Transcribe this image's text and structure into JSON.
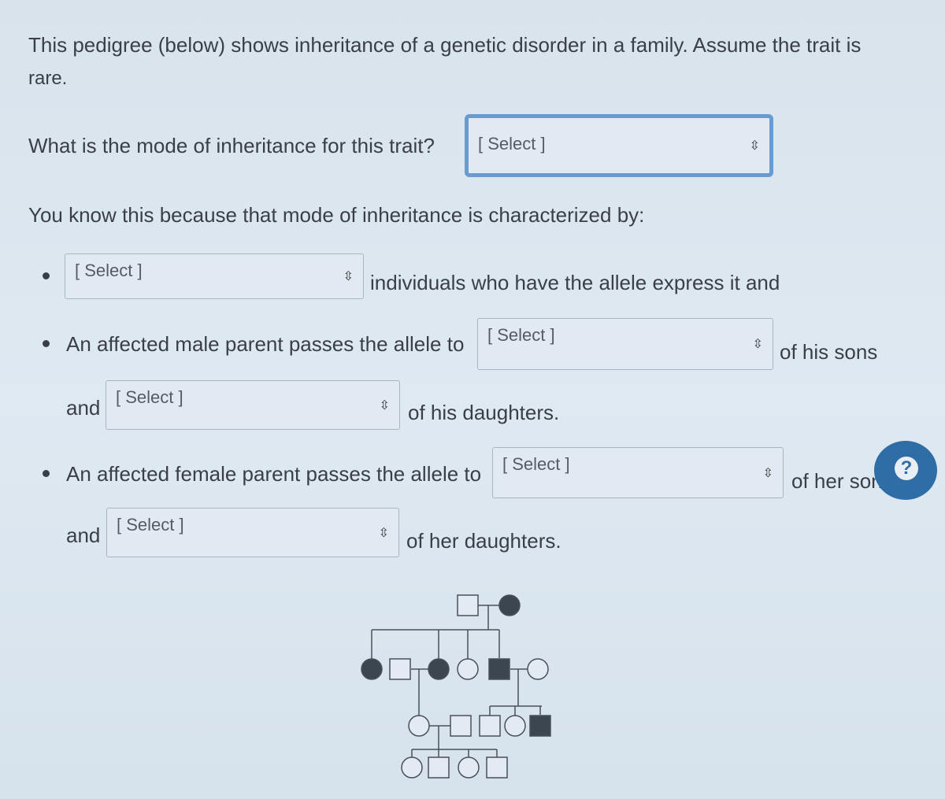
{
  "intro": "This pedigree (below) shows inheritance of a genetic disorder in a family. Assume the trait is",
  "intro2": "rare.",
  "q1": {
    "label": "What is the mode of inheritance for this trait?",
    "select": "[ Select ]"
  },
  "q2_label": "You know this because that mode of inheritance is characterized by:",
  "b1": {
    "select": "[ Select ]",
    "after": "individuals who have the allele express it and"
  },
  "b2": {
    "before": "An affected male parent passes the allele to",
    "select": "[ Select ]",
    "after": "of his sons",
    "and": "and",
    "select2": "[ Select ]",
    "after2": "of his daughters."
  },
  "b3": {
    "before": "An affected female parent passes the allele to",
    "select": "[ Select ]",
    "after": "of her sons",
    "and": "and",
    "select2": "[ Select ]",
    "after2": "of her daughters."
  },
  "help_icon": "question-mark-icon",
  "arrow_icon": "up-down-chevron-icon",
  "colors": {
    "affected": "#3c4650",
    "focus": "#6a9bd0",
    "help": "#2f6da6"
  },
  "pedigree": {
    "generations": [
      [
        {
          "sex": "male",
          "affected": false
        },
        {
          "sex": "female",
          "affected": true
        }
      ],
      [
        {
          "sex": "female",
          "affected": true
        },
        {
          "sex": "male",
          "affected": false
        },
        {
          "sex": "female",
          "affected": true
        },
        {
          "sex": "female",
          "affected": false
        },
        {
          "sex": "male",
          "affected": true
        },
        {
          "sex": "female",
          "affected": false
        }
      ],
      [
        {
          "sex": "female",
          "affected": false
        },
        {
          "sex": "male",
          "affected": false
        },
        {
          "sex": "male",
          "affected": false
        },
        {
          "sex": "female",
          "affected": false
        },
        {
          "sex": "male",
          "affected": true
        }
      ],
      [
        {
          "sex": "female",
          "affected": false
        },
        {
          "sex": "male",
          "affected": false
        },
        {
          "sex": "female",
          "affected": false
        },
        {
          "sex": "male",
          "affected": false
        }
      ]
    ]
  }
}
